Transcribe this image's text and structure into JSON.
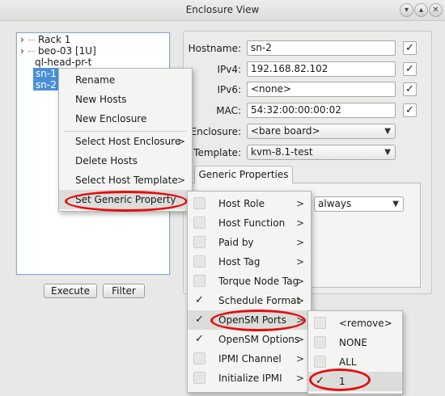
{
  "window": {
    "title": "Enclosure View"
  },
  "titlebar_buttons": [
    "▾",
    "▴",
    "✕"
  ],
  "tree": {
    "items": [
      {
        "text": "Rack 1",
        "expander": "›",
        "selected": false
      },
      {
        "text": "beo-03 [1U]",
        "expander": "›",
        "selected": false
      },
      {
        "text": "ql-head-pr-t",
        "expander": "",
        "selected": false
      },
      {
        "text": "sn-1",
        "expander": "",
        "selected": true
      },
      {
        "text": "sn-2",
        "expander": "",
        "selected": true
      }
    ]
  },
  "buttons": {
    "execute": "Execute",
    "filter": "Filter"
  },
  "form": {
    "hostname_label": "Hostname:",
    "hostname_value": "sn-2",
    "ipv4_label": "IPv4:",
    "ipv4_value": "192.168.82.102",
    "ipv6_label": "IPv6:",
    "ipv6_value": "<none>",
    "mac_label": "MAC:",
    "mac_value": "54:32:00:00:00:02",
    "enclosure_label": "Enclosure:",
    "enclosure_value": "<bare board>",
    "template_label": "Template:",
    "template_value": "kvm-8.1-test",
    "check_mark": "✓"
  },
  "tabs": {
    "generic_properties": "Generic Properties"
  },
  "property_value": "always",
  "context_menu": {
    "items": [
      "Rename",
      "New Hosts",
      "New Enclosure",
      "Select Host Enclosure",
      "Delete Hosts",
      "Select Host Template",
      "Set Generic Property"
    ],
    "submenu_arrow": ">"
  },
  "property_menu": {
    "items": [
      {
        "label": "Host Role",
        "checked": false
      },
      {
        "label": "Host Function",
        "checked": false
      },
      {
        "label": "Paid by",
        "checked": false
      },
      {
        "label": "Host Tag",
        "checked": false
      },
      {
        "label": "Torque Node Tag",
        "checked": false
      },
      {
        "label": "Schedule Format",
        "checked": true
      },
      {
        "label": "OpenSM Ports",
        "checked": true
      },
      {
        "label": "OpenSM Options",
        "checked": true
      },
      {
        "label": "IPMI Channel",
        "checked": false
      },
      {
        "label": "Initialize IPMI",
        "checked": false
      }
    ],
    "check_glyph": "✓",
    "submenu_arrow": ">"
  },
  "value_menu": {
    "items": [
      {
        "label": "<remove>",
        "checked": false
      },
      {
        "label": "NONE",
        "checked": false
      },
      {
        "label": "ALL",
        "checked": false
      },
      {
        "label": "1",
        "checked": true
      }
    ],
    "check_glyph": "✓"
  },
  "colors": {
    "selection": "#4a90d9",
    "highlight_ring": "#e21010"
  }
}
